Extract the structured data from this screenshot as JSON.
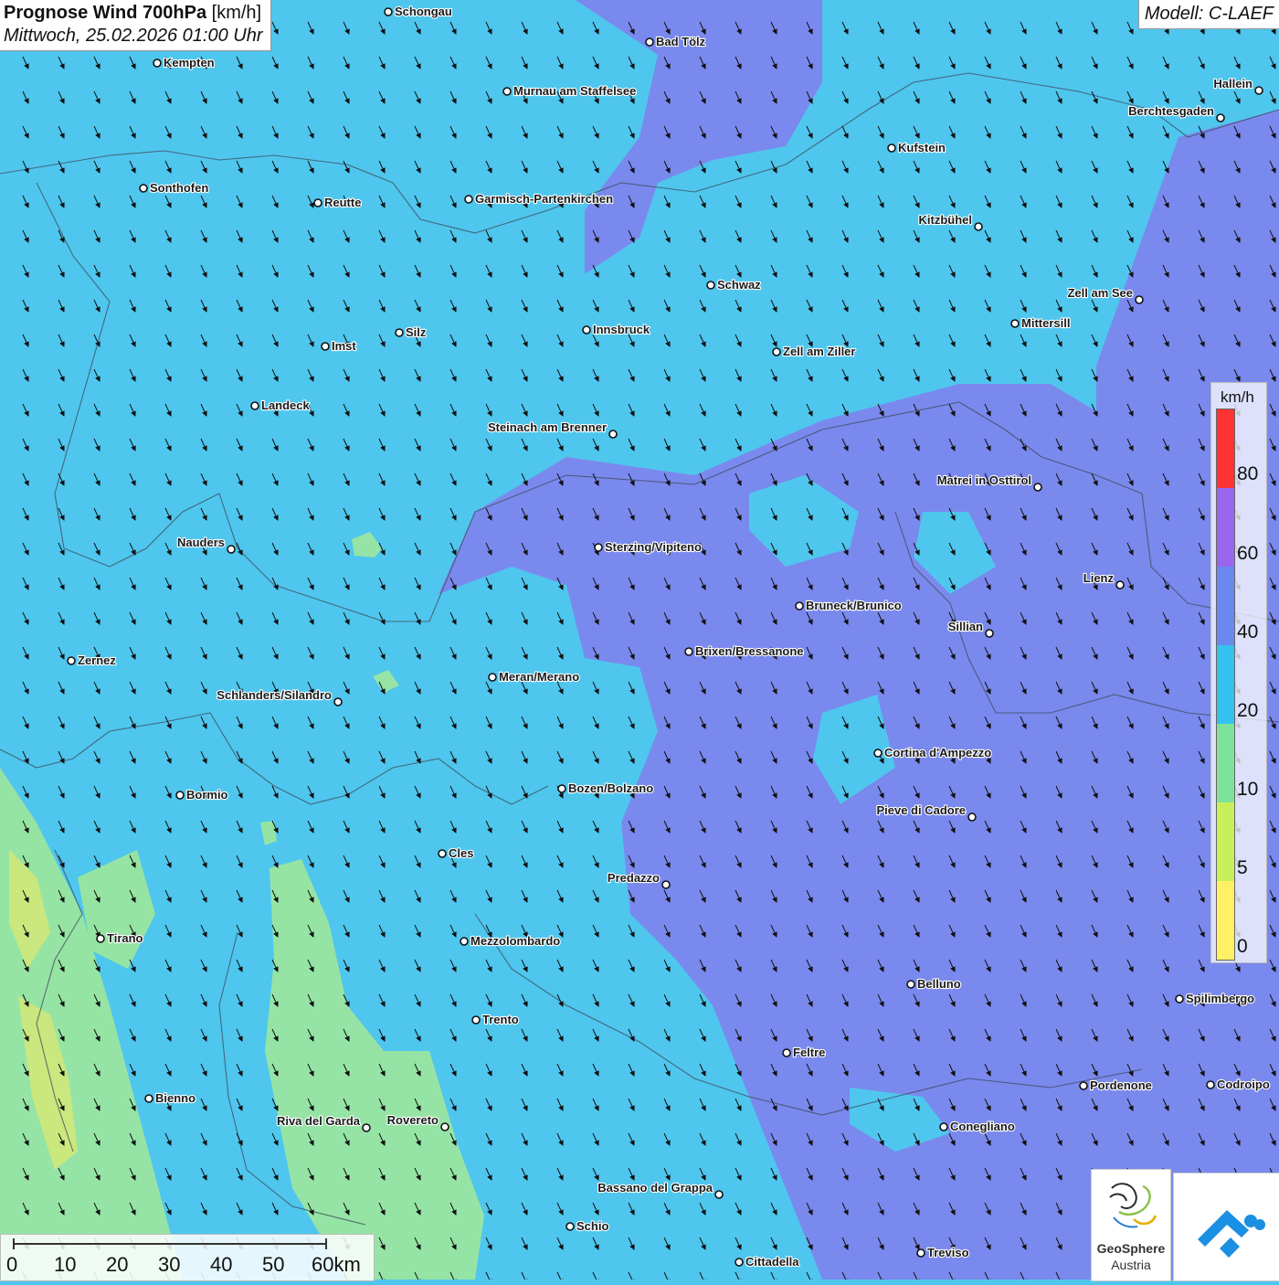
{
  "title": {
    "main": "Prognose Wind 700hPa",
    "unit": "[km/h]",
    "datetime": "Mittwoch, 25.02.2026 01:00 Uhr"
  },
  "model": "Modell: C-LAEF",
  "legend": {
    "unit": "km/h",
    "ticks": [
      "80",
      "60",
      "40",
      "20",
      "10",
      "5",
      "0"
    ],
    "colors": [
      "#ff3333",
      "#9966ee",
      "#6a88f0",
      "#33c2f0",
      "#7de39a",
      "#c8f05a",
      "#fff066"
    ]
  },
  "scalebar": {
    "labels": [
      "0",
      "10",
      "20",
      "30",
      "40",
      "50",
      "60km"
    ]
  },
  "logos": {
    "geosphere_name": "GeoSphere",
    "geosphere_sub": "Austria"
  },
  "wind_direction": "north-northwest",
  "colors": {
    "sky_band": "#4fc6ee",
    "strong_band": "#7c86ec",
    "weak_band": "#9ae6a0",
    "very_weak_band": "#cfe87a"
  },
  "cities": [
    {
      "name": "Schongau",
      "side": "right"
    },
    {
      "name": "Bad Tölz",
      "side": "right"
    },
    {
      "name": "Kempten",
      "side": "right"
    },
    {
      "name": "Murnau am Staffelsee",
      "side": "right"
    },
    {
      "name": "Hallein",
      "side": "left"
    },
    {
      "name": "Berchtesgaden",
      "side": "left"
    },
    {
      "name": "Kufstein",
      "side": "right"
    },
    {
      "name": "Sonthofen",
      "side": "right"
    },
    {
      "name": "Reutte",
      "side": "right"
    },
    {
      "name": "Garmisch-Partenkirchen",
      "side": "right"
    },
    {
      "name": "Kitzbühel",
      "side": "left"
    },
    {
      "name": "Schwaz",
      "side": "right"
    },
    {
      "name": "Zell am See",
      "side": "left"
    },
    {
      "name": "Mittersill",
      "side": "right"
    },
    {
      "name": "Innsbruck",
      "side": "right"
    },
    {
      "name": "Silz",
      "side": "right"
    },
    {
      "name": "Imst",
      "side": "right"
    },
    {
      "name": "Zell am Ziller",
      "side": "right"
    },
    {
      "name": "Landeck",
      "side": "right"
    },
    {
      "name": "Steinach am Brenner",
      "side": "left"
    },
    {
      "name": "Matrei in Osttirol",
      "side": "left"
    },
    {
      "name": "Nauders",
      "side": "left"
    },
    {
      "name": "Sterzing/Vipiteno",
      "side": "right"
    },
    {
      "name": "Lienz",
      "side": "left"
    },
    {
      "name": "Bruneck/Brunico",
      "side": "right"
    },
    {
      "name": "Sillian",
      "side": "left"
    },
    {
      "name": "Brixen/Bressanone",
      "side": "right"
    },
    {
      "name": "Zernez",
      "side": "right"
    },
    {
      "name": "Meran/Merano",
      "side": "right"
    },
    {
      "name": "Schlanders/Silandro",
      "side": "left"
    },
    {
      "name": "Cortina d'Ampezzo",
      "side": "right"
    },
    {
      "name": "Bozen/Bolzano",
      "side": "right"
    },
    {
      "name": "Bormio",
      "side": "right"
    },
    {
      "name": "Pieve di Cadore",
      "side": "left"
    },
    {
      "name": "Cles",
      "side": "right"
    },
    {
      "name": "Predazzo",
      "side": "left"
    },
    {
      "name": "Tirano",
      "side": "right"
    },
    {
      "name": "Mezzolombardo",
      "side": "right"
    },
    {
      "name": "Belluno",
      "side": "right"
    },
    {
      "name": "Spilimbergo",
      "side": "right"
    },
    {
      "name": "Trento",
      "side": "right"
    },
    {
      "name": "Feltre",
      "side": "right"
    },
    {
      "name": "Pordenone",
      "side": "right"
    },
    {
      "name": "Codroipo",
      "side": "right"
    },
    {
      "name": "Bienno",
      "side": "right"
    },
    {
      "name": "Riva del Garda",
      "side": "left"
    },
    {
      "name": "Rovereto",
      "side": "left"
    },
    {
      "name": "Conegliano",
      "side": "right"
    },
    {
      "name": "Bassano del Grappa",
      "side": "left"
    },
    {
      "name": "Schio",
      "side": "right"
    },
    {
      "name": "Treviso",
      "side": "right"
    },
    {
      "name": "Cittadella",
      "side": "right"
    }
  ]
}
